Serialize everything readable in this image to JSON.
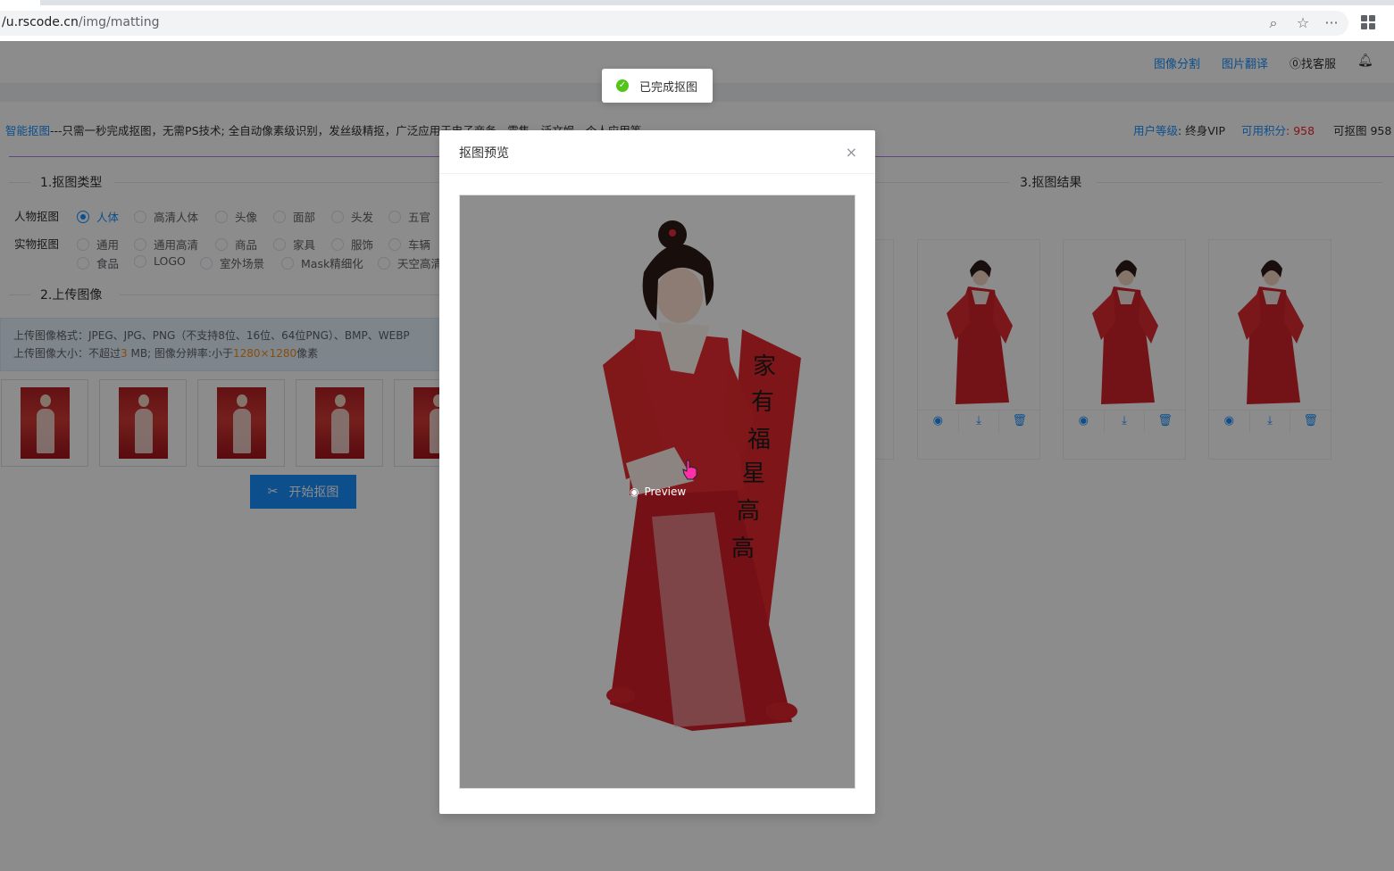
{
  "browser": {
    "url_host": "/u.rscode.cn",
    "url_path": "/img/matting"
  },
  "header": {
    "nav_segment": "图像分割",
    "nav_translate": "图片翻译",
    "help": "⓪找客服"
  },
  "intro": {
    "link": "智能抠图",
    "text": "---只需一秒完成抠图，无需PS技术; 全自动像素级识别，发丝级精抠，广泛应用于电子商务、零售、泛文娱、个人应用等"
  },
  "user": {
    "level_label": "用户等级",
    "level_value": ": 终身VIP",
    "points_label": "可用积分",
    "points_value": ": 958",
    "matting_label": "可抠图 958"
  },
  "sections": {
    "type": "1.抠图类型",
    "upload": "2.上传图像",
    "result": "3.抠图结果"
  },
  "type_rows": {
    "person_label": "人物抠图",
    "object_label": "实物抠图"
  },
  "person_options": [
    "人体",
    "高清人体",
    "头像",
    "面部",
    "头发",
    "五官"
  ],
  "object_options_row1": [
    "通用",
    "通用高清",
    "商品",
    "家具",
    "服饰",
    "车辆"
  ],
  "object_options_row2": [
    "食品",
    "LOGO",
    "室外场景",
    "Mask精细化",
    "天空高清"
  ],
  "upload_note": {
    "line1": "上传图像格式：JPEG、JPG、PNG（不支持8位、16位、64位PNG）、BMP、WEBP",
    "line2_a": "上传图像大小：不超过",
    "line2_size": "3",
    "line2_b": " MB; 图像分辨率:小于",
    "line2_res": "1280×1280",
    "line2_c": "像素"
  },
  "start_button": "开始抠图",
  "toast": "已完成抠图",
  "modal": {
    "title": "抠图预览",
    "close": "×",
    "preview_label": "Preview"
  },
  "icons": {
    "search": "search-icon",
    "star": "star-icon",
    "more": "more-icon",
    "eye": "eye-icon",
    "download": "download-icon",
    "delete": "trash-icon"
  },
  "colors": {
    "primary": "#1890ff",
    "accent_line": "#b37feb",
    "success": "#52c41a",
    "danger": "#f5222d"
  }
}
